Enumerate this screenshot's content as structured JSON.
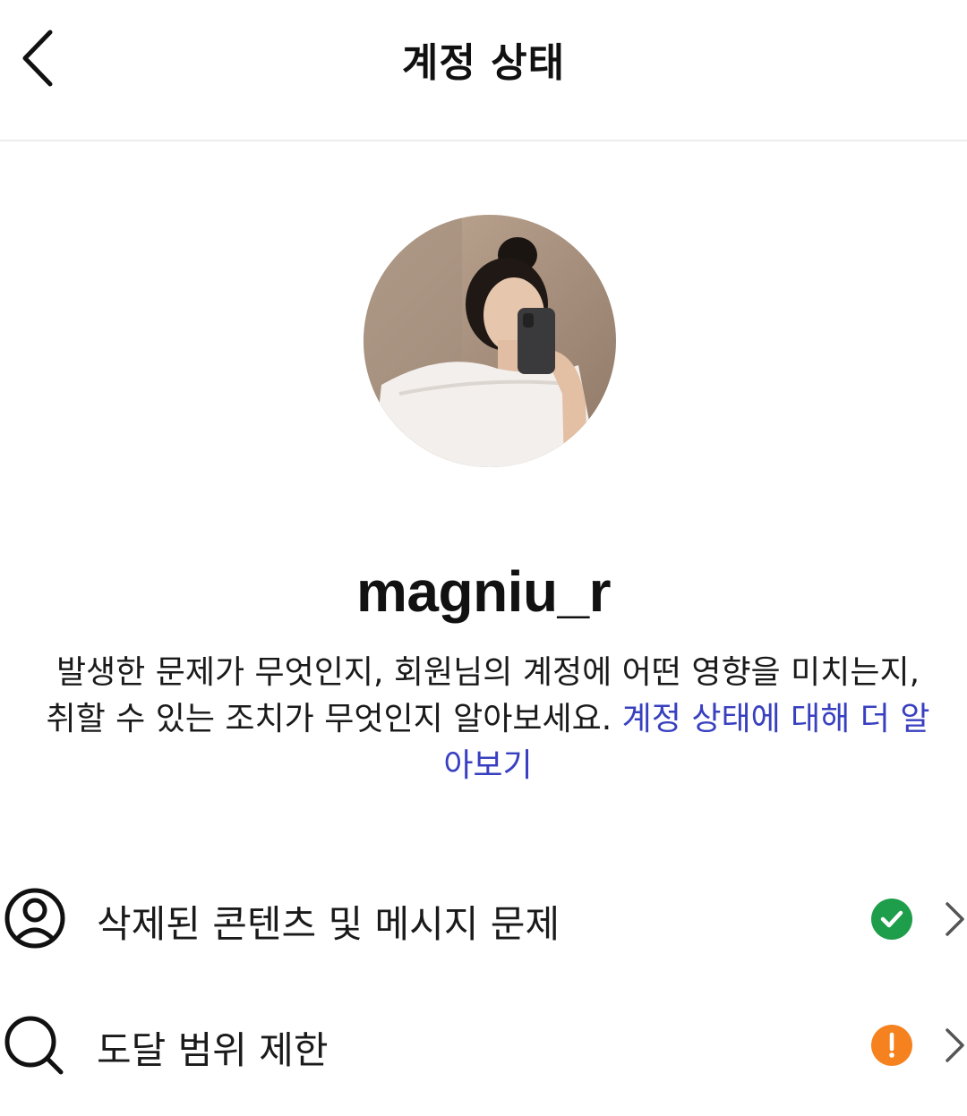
{
  "header": {
    "title": "계정 상태"
  },
  "profile": {
    "username": "magniu_r"
  },
  "description": {
    "text": "발생한 문제가 무엇인지, 회원님의 계정에 어떤 영향을 미치는지, 취할 수 있는 조치가 무엇인지 알아보세요. ",
    "link": "계정 상태에 대해 더 알아보기"
  },
  "status_items": [
    {
      "label": "삭제된 콘텐츠 및 메시지 문제",
      "icon": "person-circle-icon",
      "status": "ok",
      "status_color": "#1e9e4a"
    },
    {
      "label": "도달 범위 제한",
      "icon": "search-icon",
      "status": "warning",
      "status_color": "#f5821f"
    }
  ],
  "colors": {
    "link": "#3940c0",
    "ok": "#1e9e4a",
    "warning": "#f5821f"
  }
}
